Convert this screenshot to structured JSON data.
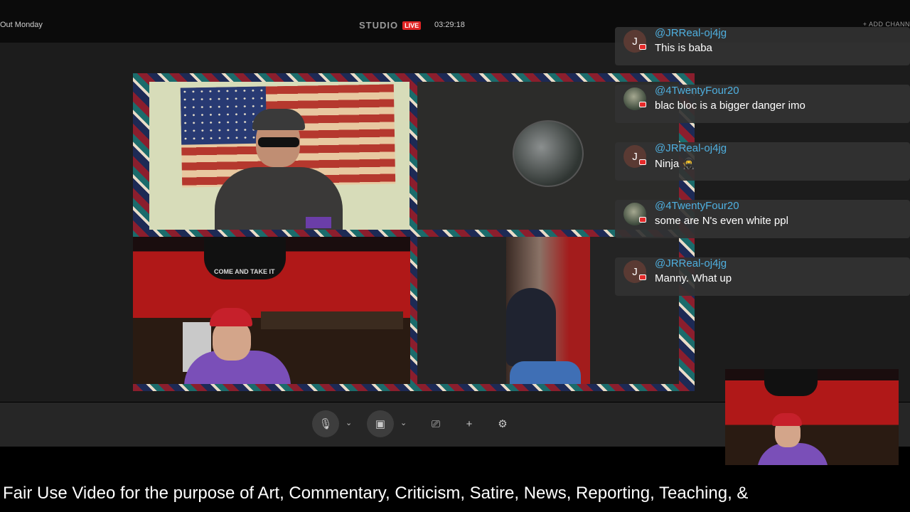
{
  "topbar": {
    "show_title": "Out Monday",
    "studio_label": "STUDIO",
    "live_badge": "LIVE",
    "timer": "03:29:18",
    "add_channel": "+ ADD CHANN"
  },
  "stage": {
    "tile_banner_text": "COME AND TAKE IT"
  },
  "chat": {
    "messages": [
      {
        "avatar": "J",
        "user": "@JRReal-oj4jg",
        "text": "This is baba"
      },
      {
        "avatar": "",
        "user": "@4TwentyFour20",
        "text": "blac bloc is a bigger danger imo"
      },
      {
        "avatar": "J",
        "user": "@JRReal-oj4jg",
        "text": "Ninja 🥷"
      },
      {
        "avatar": "",
        "user": "@4TwentyFour20",
        "text": "some are N's even white ppl"
      },
      {
        "avatar": "J",
        "user": "@JRReal-oj4jg",
        "text": "Manny. What up"
      }
    ]
  },
  "controls": {
    "mic": "🎙",
    "camera": "▣",
    "share": "⎚",
    "add": "+",
    "settings": "⚙",
    "chevron": "⌄"
  },
  "colors": {
    "live_red": "#e02424",
    "username_blue": "#4fb0e0",
    "chat_bg": "#323232"
  },
  "disclaimer": "Fair Use Video for the purpose of Art, Commentary, Criticism, Satire, News, Reporting, Teaching, &"
}
